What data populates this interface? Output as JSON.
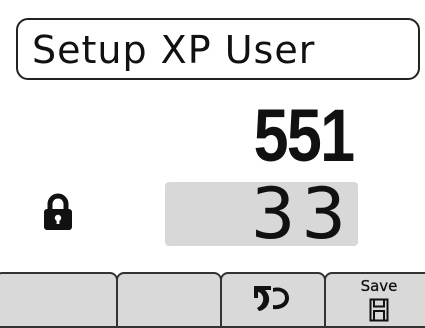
{
  "header": {
    "title": "Setup XP User"
  },
  "main": {
    "primary_value": "551",
    "secondary_value": "33",
    "lock_icon": "lock-icon"
  },
  "softkeys": [
    {
      "label": "",
      "icon": ""
    },
    {
      "label": "",
      "icon": ""
    },
    {
      "label": "",
      "icon": "undo-icon"
    },
    {
      "label": "Save",
      "icon": "floppy-disk-icon"
    }
  ],
  "colors": {
    "background": "#ffffff",
    "text": "#111111",
    "field_fill": "#d8d8d8",
    "softkey_fill": "#d9d9d9"
  }
}
